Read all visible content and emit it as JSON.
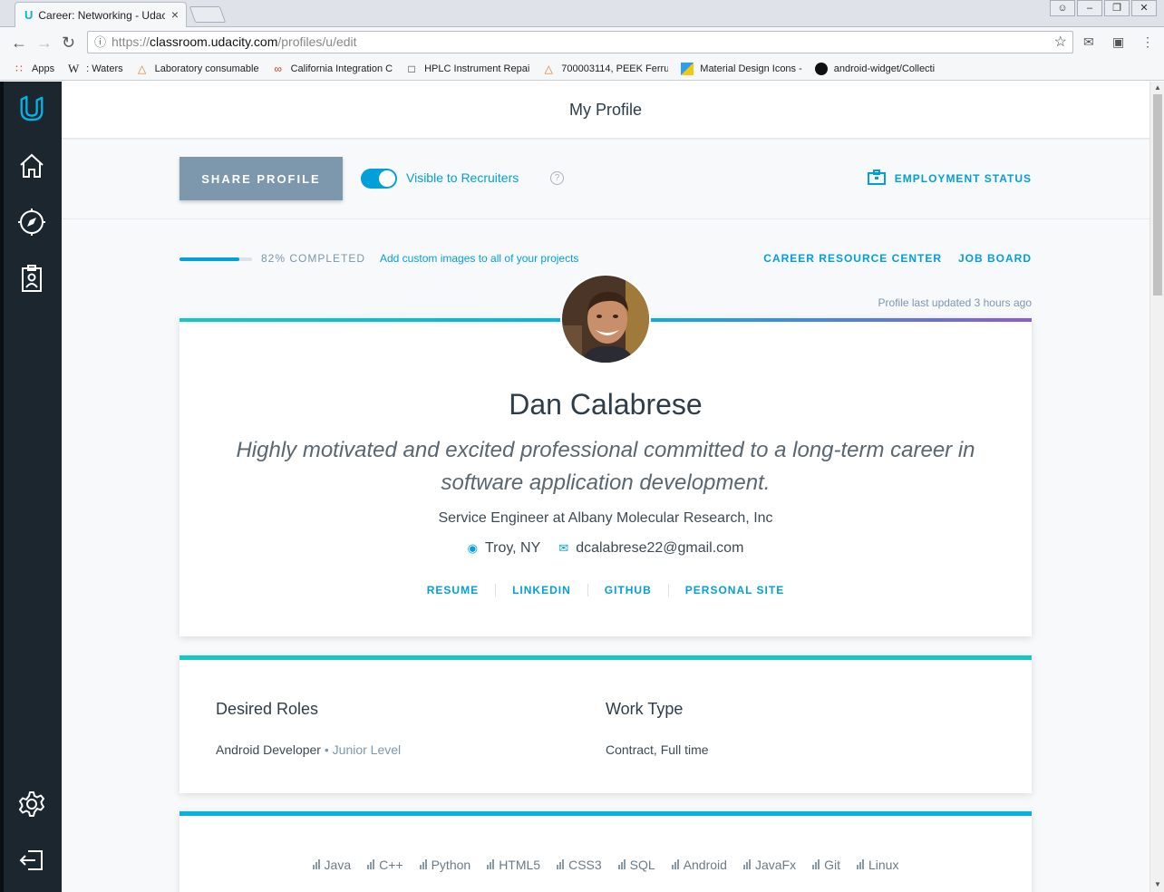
{
  "browser": {
    "tab_title": "Career: Networking - Udaci",
    "url_protocol": "https://",
    "url_host": "classroom.udacity.com",
    "url_path": "/profiles/u/edit",
    "bookmarks": [
      {
        "label": "Apps",
        "icon": "apps-grid-icon"
      },
      {
        "label": ": Waters",
        "icon": "w-icon"
      },
      {
        "label": "Laboratory consumable",
        "icon": "flask-icon"
      },
      {
        "label": "California Integration C",
        "icon": "ci-icon"
      },
      {
        "label": "HPLC Instrument Repai",
        "icon": "page-icon"
      },
      {
        "label": "700003114, PEEK Ferru",
        "icon": "flask-icon"
      },
      {
        "label": "Material Design Icons -",
        "icon": "md-icon"
      },
      {
        "label": "android-widget/Collecti",
        "icon": "github-icon"
      }
    ]
  },
  "header": {
    "title": "My Profile"
  },
  "actions": {
    "share_label": "SHARE PROFILE",
    "visible_label": "Visible to Recruiters",
    "visible_on": true,
    "help_glyph": "?",
    "employment_label": "EMPLOYMENT STATUS"
  },
  "progress": {
    "percent": 82,
    "label": "82% COMPLETED",
    "hint": "Add custom images to all of your projects",
    "career_link": "CAREER RESOURCE CENTER",
    "job_link": "JOB BOARD",
    "updated": "Profile last updated 3 hours ago"
  },
  "profile": {
    "name": "Dan Calabrese",
    "tagline": "Highly motivated and excited professional committed to a long-term career in software application development.",
    "job": "Service Engineer at Albany Molecular Research, Inc",
    "location": "Troy, NY",
    "email": "dcalabrese22@gmail.com",
    "links": [
      "RESUME",
      "LINKEDIN",
      "GITHUB",
      "PERSONAL SITE"
    ]
  },
  "roles": {
    "desired_title": "Desired Roles",
    "desired_role": "Android Developer",
    "desired_sep": " • ",
    "desired_level": "Junior Level",
    "work_title": "Work Type",
    "work_value": "Contract, Full time"
  },
  "skills": [
    "Java",
    "C++",
    "Python",
    "HTML5",
    "CSS3",
    "SQL",
    "Android",
    "JavaFx",
    "Git",
    "Linux"
  ],
  "colors": {
    "accent": "#02a0d9",
    "sidebar": "#1c262f",
    "share_button": "#7d97ad",
    "teal": "#15c8c0",
    "purple": "#8b5cd6"
  }
}
